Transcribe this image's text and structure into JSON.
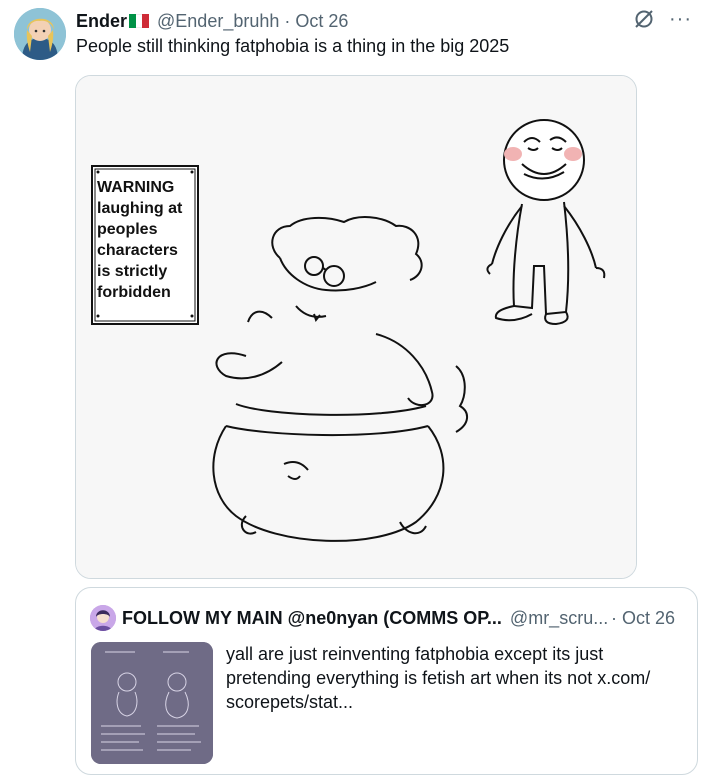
{
  "author": {
    "name": "Ender",
    "handle": "@Ender_bruhh",
    "separator": "·",
    "date": "Oct 26",
    "flag_colors": [
      "#009246",
      "#ffffff",
      "#ce2b37"
    ]
  },
  "tweet": {
    "text": "People still thinking fatphobia is a thing in the big 2025"
  },
  "icons": {
    "grok": "grok-icon",
    "more": "more-icon",
    "more_glyph": "···"
  },
  "image": {
    "sign_lines": [
      "WARNING",
      "laughing at",
      "peoples",
      "characters",
      "is strictly",
      "forbidden"
    ]
  },
  "quote": {
    "name": "FOLLOW MY MAIN @ne0nyan (COMMS OP...",
    "handle": "@mr_scru...",
    "date": "· Oct 26",
    "text": "yall are just reinventing fatphobia except its just pretending everything is fetish art when its not  x.com/ scorepets/stat..."
  },
  "colors": {
    "text_primary": "#0f1419",
    "text_secondary": "#536471",
    "border": "#cfd9de"
  }
}
